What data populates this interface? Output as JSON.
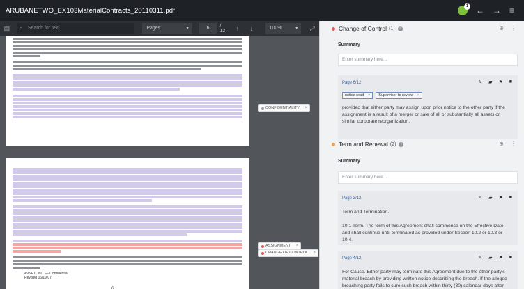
{
  "app": {
    "file_title": "ARUBANETWO_EX103MaterialContracts_20110311.pdf",
    "notification_count": "1"
  },
  "toolbar": {
    "search_placeholder": "Search for text",
    "view_mode": "Pages",
    "current_page": "6",
    "total_pages": "/ 12",
    "zoom": "100%"
  },
  "document": {
    "page1_number": "",
    "page2_number": "6",
    "footer_company": "AVNET, INC. — Confidential",
    "footer_revised": "Revised 06/19/07",
    "gutter_tags": [
      {
        "label": "CONFIDENTIALITY",
        "color": "#9aa0a6"
      },
      {
        "label": "ASSIGNMENT",
        "color": "#e05a5a"
      },
      {
        "label": "CHANGE OF CONTROL",
        "color": "#e05a5a"
      }
    ]
  },
  "panel": {
    "sections": [
      {
        "name": "Change of Control",
        "count": "(1)",
        "color": "#e05a5a",
        "summary_label": "Summary",
        "summary_placeholder": "Enter summary here...",
        "cards": [
          {
            "page": "Page 6/12",
            "tags": [
              "notice read",
              "Supervisor to review"
            ],
            "text": "provided that either party may assign upon prior notice to the other party if the assignment is a result of a merger or sale of all or substantially all assets or similar corporate reorganization."
          }
        ]
      },
      {
        "name": "Term and Renewal",
        "count": "(2)",
        "color": "#f0a14a",
        "summary_label": "Summary",
        "summary_placeholder": "Enter summary here...",
        "cards": [
          {
            "page": "Page 3/12",
            "title": "Term and Termination.",
            "text": "10.1 Term. The term of this Agreement shall commence on the Effective Date and shall continue until terminated as provided under Section 10.2 or 10.3 or 10.4."
          },
          {
            "page": "Page 4/12",
            "text": "For Cause. Either party may terminate this Agreement due to the other party's material breach by providing written notice describing the breach. If the alleged breaching party fails to cure such breach within thirty (30) calendar days after"
          }
        ]
      }
    ]
  }
}
